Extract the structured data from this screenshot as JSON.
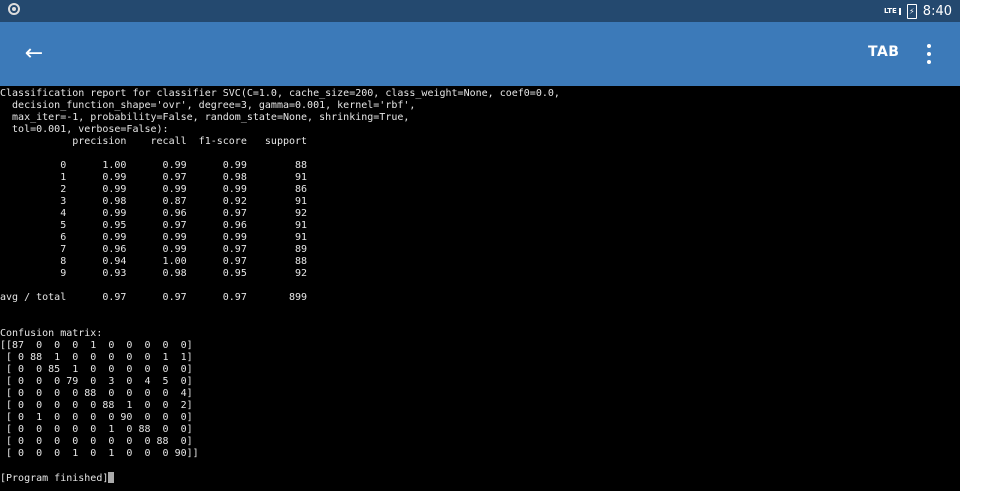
{
  "statusbar": {
    "network": "LTE",
    "time": "8:40"
  },
  "appbar": {
    "tab_label": "TAB"
  },
  "icons": {
    "back": "arrow-back-icon",
    "menu": "more-vert-icon"
  },
  "colors": {
    "statusbar": "#24496f",
    "appbar": "#3c7ab9",
    "terminal_bg": "#000000"
  },
  "terminal": {
    "header_lines": [
      "Classification report for classifier SVC(C=1.0, cache_size=200, class_weight=None, coef0=0.0,",
      "  decision_function_shape='ovr', degree=3, gamma=0.001, kernel='rbf',",
      "  max_iter=-1, probability=False, random_state=None, shrinking=True,",
      "  tol=0.001, verbose=False):"
    ],
    "report_columns": [
      "precision",
      "recall",
      "f1-score",
      "support"
    ],
    "report_rows": [
      {
        "label": "0",
        "precision": "1.00",
        "recall": "0.99",
        "f1": "0.99",
        "support": "88"
      },
      {
        "label": "1",
        "precision": "0.99",
        "recall": "0.97",
        "f1": "0.98",
        "support": "91"
      },
      {
        "label": "2",
        "precision": "0.99",
        "recall": "0.99",
        "f1": "0.99",
        "support": "86"
      },
      {
        "label": "3",
        "precision": "0.98",
        "recall": "0.87",
        "f1": "0.92",
        "support": "91"
      },
      {
        "label": "4",
        "precision": "0.99",
        "recall": "0.96",
        "f1": "0.97",
        "support": "92"
      },
      {
        "label": "5",
        "precision": "0.95",
        "recall": "0.97",
        "f1": "0.96",
        "support": "91"
      },
      {
        "label": "6",
        "precision": "0.99",
        "recall": "0.99",
        "f1": "0.99",
        "support": "91"
      },
      {
        "label": "7",
        "precision": "0.96",
        "recall": "0.99",
        "f1": "0.97",
        "support": "89"
      },
      {
        "label": "8",
        "precision": "0.94",
        "recall": "1.00",
        "f1": "0.97",
        "support": "88"
      },
      {
        "label": "9",
        "precision": "0.93",
        "recall": "0.98",
        "f1": "0.95",
        "support": "92"
      }
    ],
    "report_total": {
      "label": "avg / total",
      "precision": "0.97",
      "recall": "0.97",
      "f1": "0.97",
      "support": "899"
    },
    "confusion_title": "Confusion matrix:",
    "confusion_matrix": [
      [
        87,
        0,
        0,
        0,
        1,
        0,
        0,
        0,
        0,
        0
      ],
      [
        0,
        88,
        1,
        0,
        0,
        0,
        0,
        0,
        1,
        1
      ],
      [
        0,
        0,
        85,
        1,
        0,
        0,
        0,
        0,
        0,
        0
      ],
      [
        0,
        0,
        0,
        79,
        0,
        3,
        0,
        4,
        5,
        0
      ],
      [
        0,
        0,
        0,
        0,
        88,
        0,
        0,
        0,
        0,
        4
      ],
      [
        0,
        0,
        0,
        0,
        0,
        88,
        1,
        0,
        0,
        2
      ],
      [
        0,
        1,
        0,
        0,
        0,
        0,
        90,
        0,
        0,
        0
      ],
      [
        0,
        0,
        0,
        0,
        0,
        1,
        0,
        88,
        0,
        0
      ],
      [
        0,
        0,
        0,
        0,
        0,
        0,
        0,
        0,
        88,
        0
      ],
      [
        0,
        0,
        0,
        1,
        0,
        1,
        0,
        0,
        0,
        90
      ]
    ],
    "finished": "[Program finished]"
  }
}
